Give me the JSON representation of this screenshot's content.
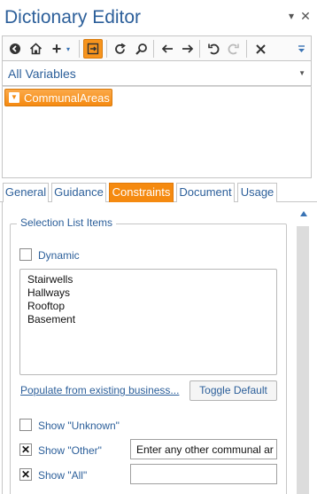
{
  "window": {
    "title": "Dictionary Editor",
    "pin_icon": "pin-icon",
    "close_icon": "close-icon"
  },
  "toolbar": {
    "buttons": [
      {
        "name": "back-icon",
        "glyph": "←"
      },
      {
        "name": "home-icon",
        "glyph": "⌂"
      },
      {
        "name": "add-icon",
        "glyph": "+"
      },
      {
        "name": "insert-icon",
        "glyph": "⇥"
      },
      {
        "name": "refresh-icon",
        "glyph": "↻"
      },
      {
        "name": "search-icon",
        "glyph": "⌕"
      },
      {
        "name": "navigate-back-icon",
        "glyph": "←"
      },
      {
        "name": "navigate-forward-icon",
        "glyph": "→"
      },
      {
        "name": "undo-icon",
        "glyph": "↶"
      },
      {
        "name": "redo-icon",
        "glyph": "↷"
      },
      {
        "name": "delete-icon",
        "glyph": "✕"
      }
    ]
  },
  "variable_selector": {
    "value": "All Variables"
  },
  "tree": {
    "selected_node": "CommunalAreas"
  },
  "tabs": [
    {
      "label": "General",
      "active": false
    },
    {
      "label": "Guidance",
      "active": false
    },
    {
      "label": "Constraints",
      "active": true
    },
    {
      "label": "Document",
      "active": false
    },
    {
      "label": "Usage",
      "active": false
    }
  ],
  "constraints": {
    "group_title": "Selection List Items",
    "dynamic_label": "Dynamic",
    "dynamic_checked": false,
    "list_items": [
      "Stairwells",
      "Hallways",
      "Rooftop",
      "Basement"
    ],
    "populate_link": "Populate from existing business...",
    "toggle_default_button": "Toggle Default",
    "show_unknown_label": "Show \"Unknown\"",
    "show_unknown_checked": false,
    "show_other_label": "Show \"Other\"",
    "show_other_checked": true,
    "show_other_text": "Enter any other communal ar",
    "show_all_label": "Show \"All\"",
    "show_all_checked": true,
    "show_all_text": ""
  },
  "colors": {
    "accent_orange": "#f58a10",
    "link_blue": "#2c5f9a",
    "border_gray": "#c6c6c6"
  }
}
